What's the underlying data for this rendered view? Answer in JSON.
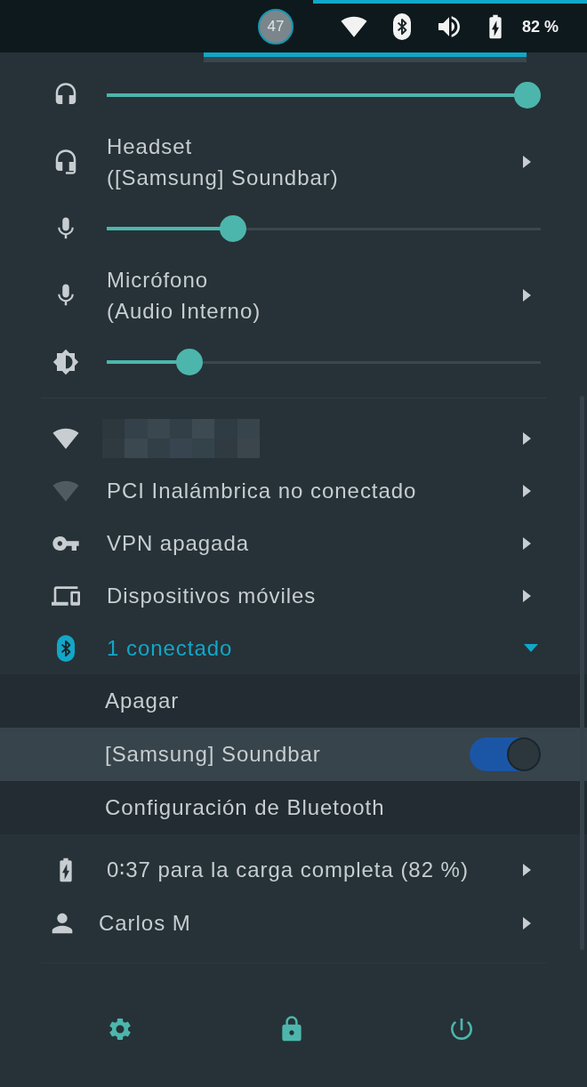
{
  "top_bar": {
    "notification_count": "47",
    "battery_percent": "82 %",
    "menu_open": true
  },
  "audio": [
    {
      "kind": "slider",
      "level": 0.97
    },
    {
      "kind": "device",
      "label": "Headset",
      "detail": "([Samsung] Soundbar)"
    },
    {
      "kind": "slider",
      "level": 0.29
    },
    {
      "kind": "device",
      "label": "Micrófono",
      "detail": "(Audio Interno)"
    },
    {
      "kind": "slider",
      "level": 0.19
    }
  ],
  "network": [
    {
      "kind": "blurred"
    },
    {
      "kind": "item",
      "label": "PCI Inalámbrica no conectado"
    },
    {
      "kind": "item",
      "label": "VPN apagada"
    },
    {
      "kind": "item",
      "label": "Dispositivos móviles"
    },
    {
      "kind": "expander",
      "label": "1 conectado",
      "expanded": true,
      "children": [
        {
          "kind": "action",
          "label": "Apagar",
          "selected": false
        },
        {
          "kind": "switch",
          "label": "[Samsung] Soundbar",
          "on": true,
          "selected": true
        },
        {
          "kind": "action",
          "label": "Configuración de Bluetooth",
          "selected": false
        }
      ]
    }
  ],
  "system": [
    {
      "kind": "item",
      "label": "0∶37 para la carga completa (82 %)"
    },
    {
      "kind": "user",
      "label": "Carlos M"
    }
  ]
}
